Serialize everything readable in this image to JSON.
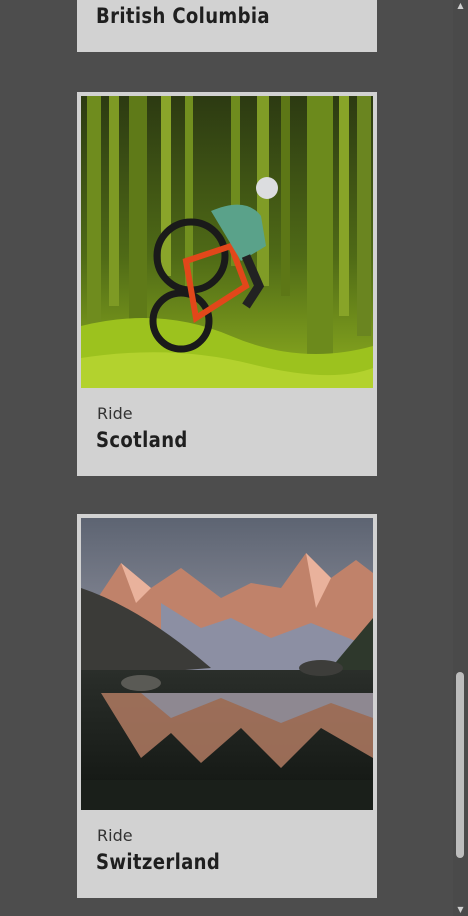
{
  "cards": [
    {
      "kicker": "",
      "title": "British Columbia"
    },
    {
      "kicker": "Ride",
      "title": "Scotland",
      "image": "mountain-biker-forest"
    },
    {
      "kicker": "Ride",
      "title": "Switzerland",
      "image": "alpine-lake-reflection"
    }
  ],
  "scrollbar": {
    "up_icon": "▲",
    "down_icon": "▼"
  },
  "colors": {
    "background": "#4d4d4d",
    "card": "#d2d2d2",
    "title": "#1f1f1f"
  }
}
